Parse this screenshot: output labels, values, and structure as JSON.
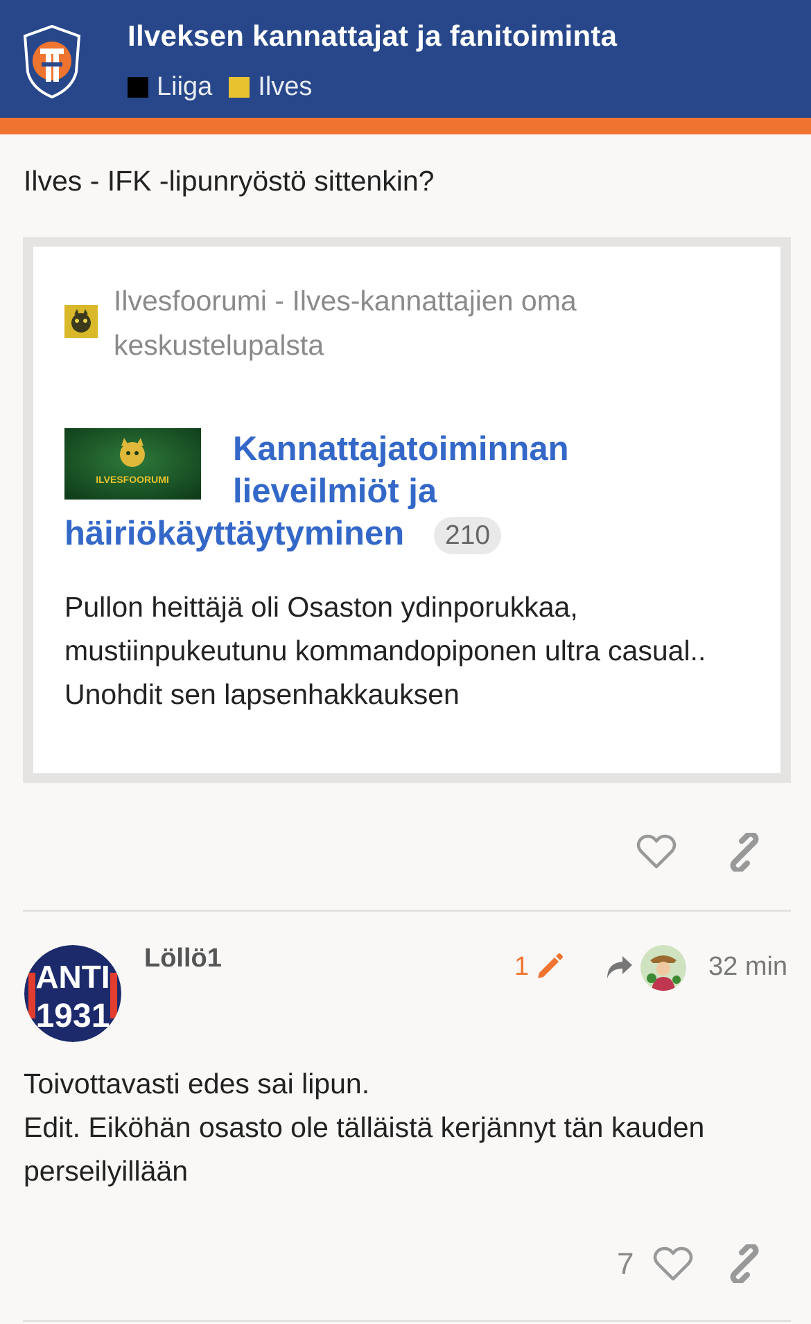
{
  "header": {
    "title": "Ilveksen kannattajat ja fanitoiminta",
    "categories": [
      {
        "label": "Liiga",
        "color": "#000000"
      },
      {
        "label": "Ilves",
        "color": "#e8c22f"
      }
    ],
    "colors": {
      "bar": "#27478a",
      "stripe": "#ef7430"
    }
  },
  "post1": {
    "text": "Ilves - IFK -lipunryöstö sittenkin?",
    "onebox": {
      "source": "Ilvesfoorumi - Ilves-kannattajien oma keskustelupalsta",
      "thumb_text": "ILVESFOORUMI",
      "title_line1": "Kannattajatoiminnan",
      "title_line2": "lieveilmiöt ja",
      "title_line3": "häiriökäyttäytyminen",
      "count": "210",
      "excerpt": "Pullon heittäjä oli Osaston ydinporukkaa, mustiinpukeutunu kommandopiponen ultra casual.. Unohdit sen lapsenhakkauksen"
    }
  },
  "post2": {
    "username": "Löllö1",
    "avatar_text_top": "ANTI",
    "avatar_text_bottom": "1931",
    "edit_count": "1",
    "time": "32 min",
    "text_line1": "Toivottavasti edes sai lipun.",
    "text_line2": "Edit. Eiköhän osasto ole tälläistä kerjännyt tän kauden perseilyillään",
    "like_count": "7"
  }
}
